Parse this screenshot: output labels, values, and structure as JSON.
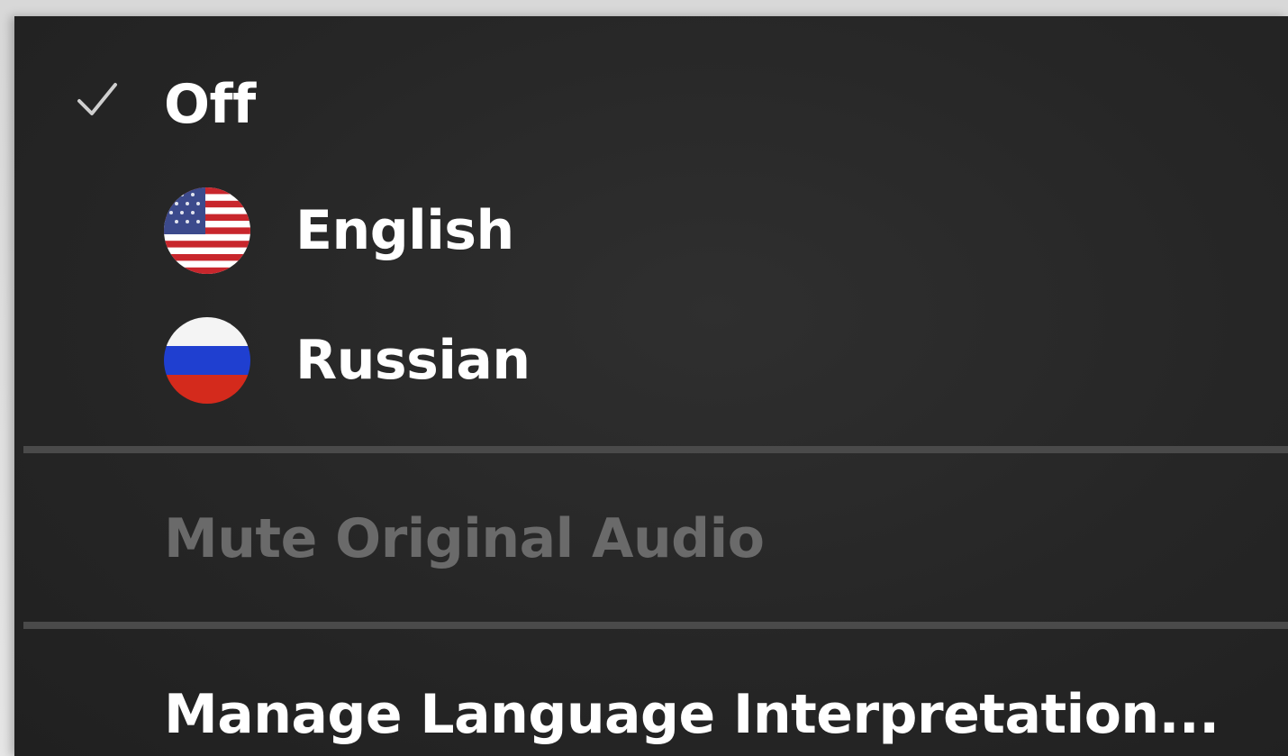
{
  "menu": {
    "items": [
      {
        "label": "Off",
        "checked": true,
        "icon": "checkmark-icon"
      },
      {
        "label": "English",
        "icon": "us-flag-icon"
      },
      {
        "label": "Russian",
        "icon": "russia-flag-icon"
      }
    ],
    "mute_label": "Mute Original Audio",
    "mute_enabled": false,
    "manage_label": "Manage Language Interpretation..."
  },
  "colors": {
    "menu_background": "#262626",
    "text": "#ffffff",
    "disabled_text": "#6a6a6a",
    "divider": "#4a4a4a"
  }
}
